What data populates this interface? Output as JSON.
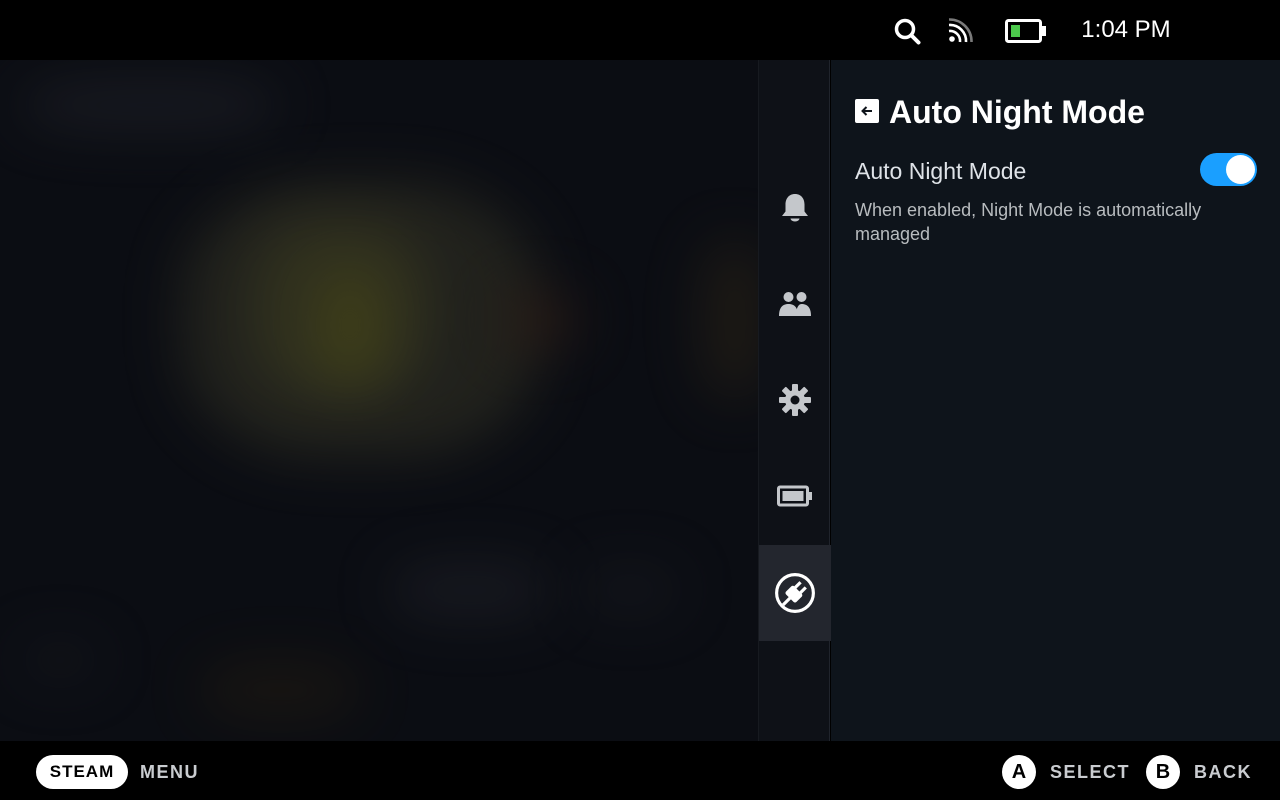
{
  "status_bar": {
    "time": "1:04 PM",
    "icons": [
      "search-icon",
      "wifi-icon",
      "battery-icon"
    ],
    "battery_color": "#4cc94c"
  },
  "sidebar": {
    "items": [
      {
        "icon": "bell-icon",
        "active": false
      },
      {
        "icon": "friends-icon",
        "active": false
      },
      {
        "icon": "gear-icon",
        "active": false
      },
      {
        "icon": "battery-icon",
        "active": false
      },
      {
        "icon": "power-plug-icon",
        "active": true
      }
    ]
  },
  "panel": {
    "title": "Auto Night Mode",
    "back_icon": "arrow-left-icon",
    "setting": {
      "label": "Auto Night Mode",
      "enabled": true,
      "description": "When enabled, Night Mode is automatically managed"
    },
    "accent_color": "#1a9fff"
  },
  "bottom_bar": {
    "steam_label": "STEAM",
    "menu_label": "MENU",
    "a_button": "A",
    "select_label": "SELECT",
    "b_button": "B",
    "back_label": "BACK"
  }
}
